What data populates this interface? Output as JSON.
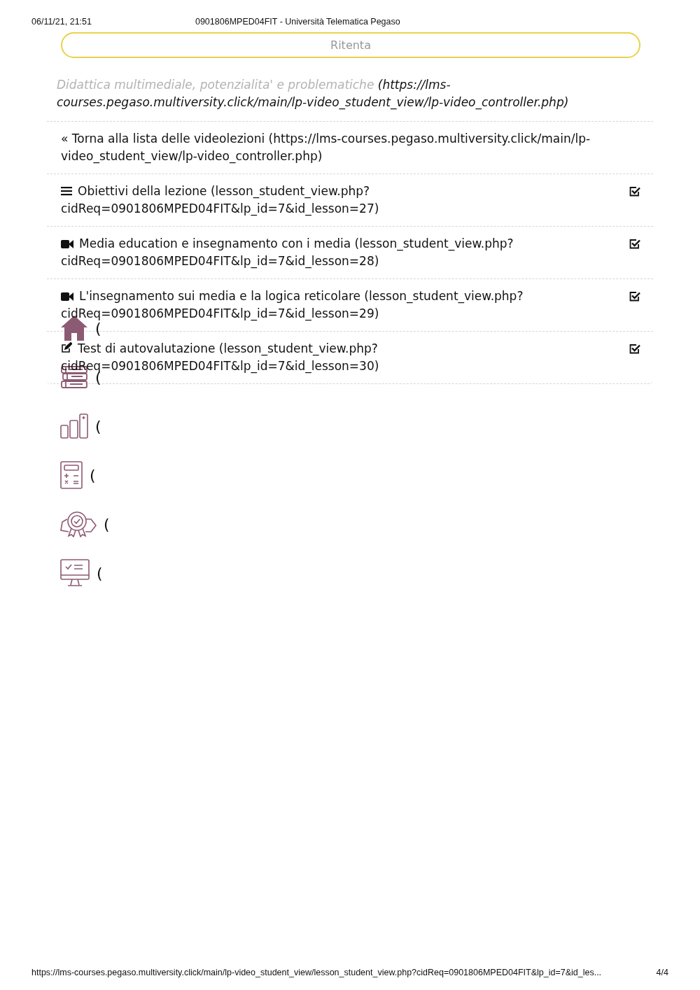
{
  "header": {
    "date": "06/11/21, 21:51",
    "title": "0901806MPED04FIT - Università Telematica Pegaso"
  },
  "retry_button": "Ritenta",
  "course_link": {
    "title": "Didattica multimediale, potenzialita' e problematiche",
    "url": "(https://lms-courses.pegaso.multiversity.click/main/lp-video_student_view/lp-video_controller.php)"
  },
  "back_link": {
    "icon": "«",
    "text": "Torna alla lista delle videolezioni (https://lms-courses.pegaso.multiversity.click/main/lp-video_student_view/lp-video_controller.php)"
  },
  "lessons": [
    {
      "kind": "document",
      "text": "Obiettivi della lezione (lesson_student_view.php?cidReq=0901806MPED04FIT&lp_id=7&id_lesson=27)",
      "checked": true
    },
    {
      "kind": "video",
      "text": "Media education e insegnamento con i media (lesson_student_view.php?cidReq=0901806MPED04FIT&lp_id=7&id_lesson=28)",
      "checked": true
    },
    {
      "kind": "video",
      "text": "L'insegnamento sui media e la logica reticolare (lesson_student_view.php?cidReq=0901806MPED04FIT&lp_id=7&id_lesson=29)",
      "checked": true
    },
    {
      "kind": "test",
      "text": "Test di autovalutazione (lesson_student_view.php?cidReq=0901806MPED04FIT&lp_id=7&id_lesson=30)",
      "checked": true
    }
  ],
  "side_nav": [
    {
      "kind": "home",
      "label": "("
    },
    {
      "kind": "books",
      "label": "("
    },
    {
      "kind": "chart",
      "label": "("
    },
    {
      "kind": "calculator",
      "label": "("
    },
    {
      "kind": "award",
      "label": "("
    },
    {
      "kind": "monitor",
      "label": "("
    }
  ],
  "footer": {
    "url": "https://lms-courses.pegaso.multiversity.click/main/lp-video_student_view/lesson_student_view.php?cidReq=0901806MPED04FIT&lp_id=7&id_les...",
    "page": "4/4"
  }
}
